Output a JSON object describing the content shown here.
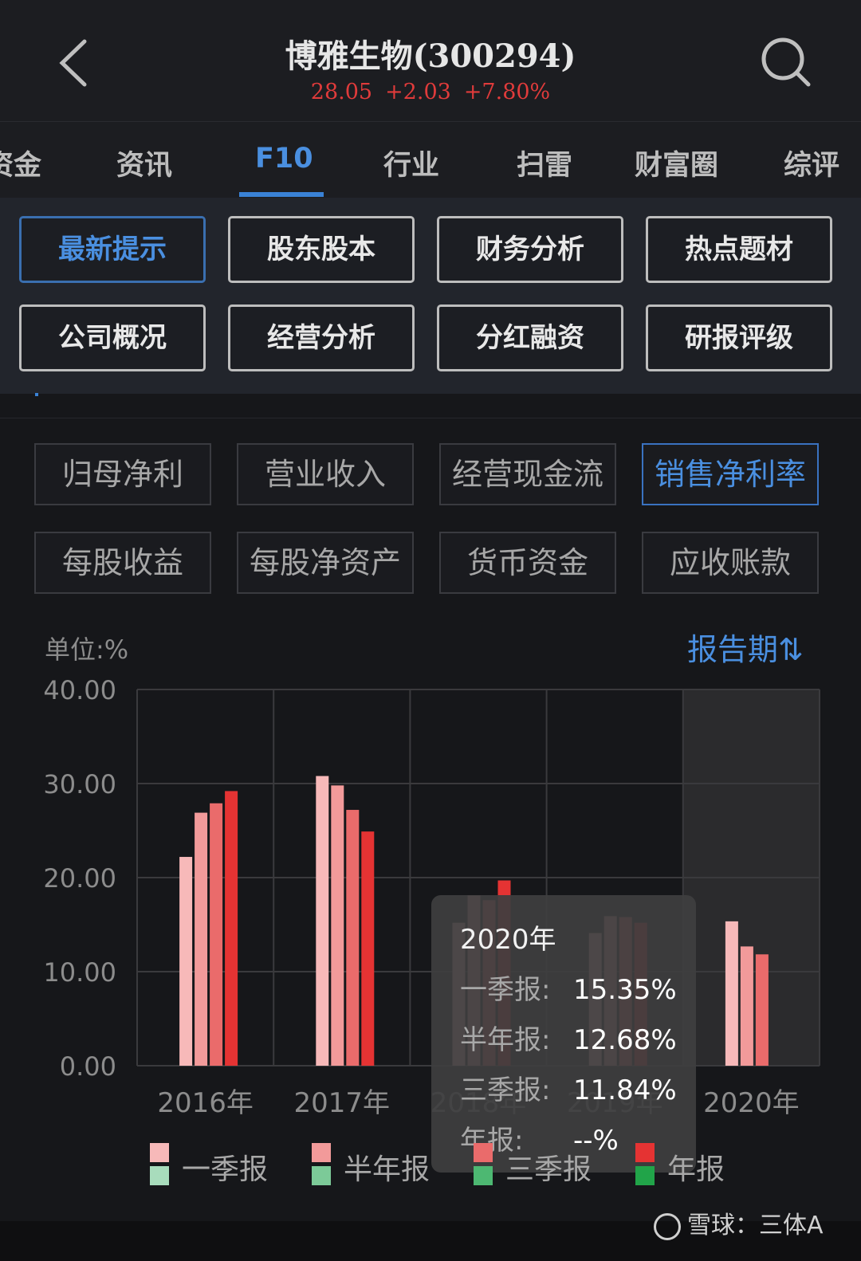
{
  "header": {
    "title": "博雅生物(300294)",
    "price": "28.05",
    "change": "+2.03",
    "change_pct": "+7.80%"
  },
  "tabs": [
    {
      "label": "资金"
    },
    {
      "label": "资讯"
    },
    {
      "label": "F10",
      "active": true
    },
    {
      "label": "行业"
    },
    {
      "label": "扫雷"
    },
    {
      "label": "财富圈"
    },
    {
      "label": "综评"
    }
  ],
  "f10_grid": [
    {
      "label": "最新提示",
      "active": true
    },
    {
      "label": "股东股本"
    },
    {
      "label": "财务分析"
    },
    {
      "label": "热点题材"
    },
    {
      "label": "公司概况"
    },
    {
      "label": "经营分析"
    },
    {
      "label": "分红融资"
    },
    {
      "label": "研报评级"
    }
  ],
  "metrics": [
    {
      "label": "归母净利"
    },
    {
      "label": "营业收入"
    },
    {
      "label": "经营现金流"
    },
    {
      "label": "销售净利率",
      "active": true
    },
    {
      "label": "每股收益"
    },
    {
      "label": "每股净资产"
    },
    {
      "label": "货币资金"
    },
    {
      "label": "应收账款"
    }
  ],
  "chart_header": {
    "unit": "单位:%",
    "period": "报告期⇅"
  },
  "chart_data": {
    "type": "bar",
    "categories": [
      "2016年",
      "2017年",
      "2018年",
      "2019年",
      "2020年"
    ],
    "ylim": [
      0,
      40
    ],
    "yticks": [
      "0.00",
      "10.00",
      "20.00",
      "30.00",
      "40.00"
    ],
    "grid": true,
    "series": [
      {
        "name": "一季报",
        "color": "#f7b9b9",
        "values": [
          22.2,
          30.8,
          15.2,
          14.1,
          15.35
        ]
      },
      {
        "name": "半年报",
        "color": "#f29a9a",
        "values": [
          26.9,
          29.8,
          18.1,
          15.9,
          12.68
        ]
      },
      {
        "name": "三季报",
        "color": "#ea6b6b",
        "values": [
          27.9,
          27.2,
          17.6,
          15.8,
          11.84
        ]
      },
      {
        "name": "年报",
        "color": "#e53333",
        "values": [
          29.2,
          24.9,
          19.7,
          15.2,
          null
        ]
      }
    ],
    "highlight_category": "2020年",
    "legend": [
      {
        "name": "一季报",
        "color": "#f7b9b9",
        "color2": "#a8dcbc"
      },
      {
        "name": "半年报",
        "color": "#f29a9a",
        "color2": "#7cca98"
      },
      {
        "name": "三季报",
        "color": "#ea6b6b",
        "color2": "#4db872"
      },
      {
        "name": "年报",
        "color": "#e53333",
        "color2": "#21a449"
      }
    ]
  },
  "tooltip": {
    "title": "2020年",
    "rows": [
      {
        "k": "一季报:",
        "v": "15.35%"
      },
      {
        "k": "半年报:",
        "v": "12.68%"
      },
      {
        "k": "三季报:",
        "v": "11.84%"
      },
      {
        "k": "年报:",
        "v": "--%"
      }
    ]
  },
  "watermark": "雪球：三体A"
}
